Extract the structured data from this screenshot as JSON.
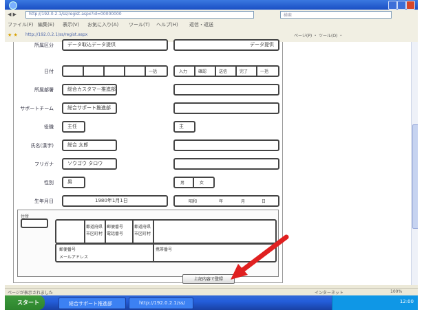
{
  "window": {
    "title": "",
    "menu_items": [
      "ファイル(F)",
      "編集(E)",
      "表示(V)",
      "お気に入り(A)",
      "ツール(T)",
      "ヘルプ(H)"
    ],
    "menu_extra": "返信・返送",
    "address_url": "http://192.0.2.1/ss/regist.aspx?id=00000000",
    "search_placeholder": "検索",
    "favorite_tab": "http://192.0.2.1/ss/regist.aspx",
    "tool_buttons": "ページ(P) ・ ツール(O) ・"
  },
  "form": {
    "rows": [
      {
        "label": "所属区分",
        "left": "データ取込データ提供",
        "right": "データ提供"
      },
      {
        "label": "日付",
        "left_cells": [
          "",
          "",
          "",
          "",
          "一括"
        ],
        "right_cells": [
          "入力",
          "確認",
          "送信",
          "完了",
          "一括"
        ]
      },
      {
        "label": "所属部署",
        "left": "総合カスタマー推進部",
        "right": ""
      },
      {
        "label": "サポートチーム",
        "left": "総合サポート推進部",
        "right": ""
      },
      {
        "label": "役職",
        "left": "主任",
        "right": "主"
      },
      {
        "label": "氏名(漢字)",
        "left": "総合 太郎",
        "right": ""
      },
      {
        "label": "フリガナ",
        "left": "ソウゴウ タロウ",
        "right": ""
      },
      {
        "label": "性別",
        "left": "男",
        "right_cells": [
          "男",
          "女"
        ]
      },
      {
        "label": "生年月日",
        "left": "1980年1月1日",
        "right_cells": [
          "昭和",
          "年",
          "月",
          "日"
        ]
      }
    ],
    "section": {
      "label": "住所",
      "small_box": "",
      "sub_labels": [
        "都道府県",
        "市区町村",
        "郵便番号",
        "電話番号",
        "都道府県",
        "市区町村"
      ],
      "row_labels": {
        "postal": "郵便番号",
        "phone": "携帯番号",
        "mail": "メールアドレス"
      }
    },
    "submit_label": "上記内容で登録"
  },
  "status": {
    "left": "ページが表示されました",
    "zone": "インターネット",
    "zoom": "100%"
  },
  "taskbar": {
    "start_label": "スタート",
    "tasks": [
      "総合サポート推進部",
      "http://192.0.2.1/ss/"
    ],
    "clock": "12:00"
  },
  "colors": {
    "arrow": "#e02020",
    "taskbar": "#245edb",
    "titlebar": "#1a4fc4"
  }
}
